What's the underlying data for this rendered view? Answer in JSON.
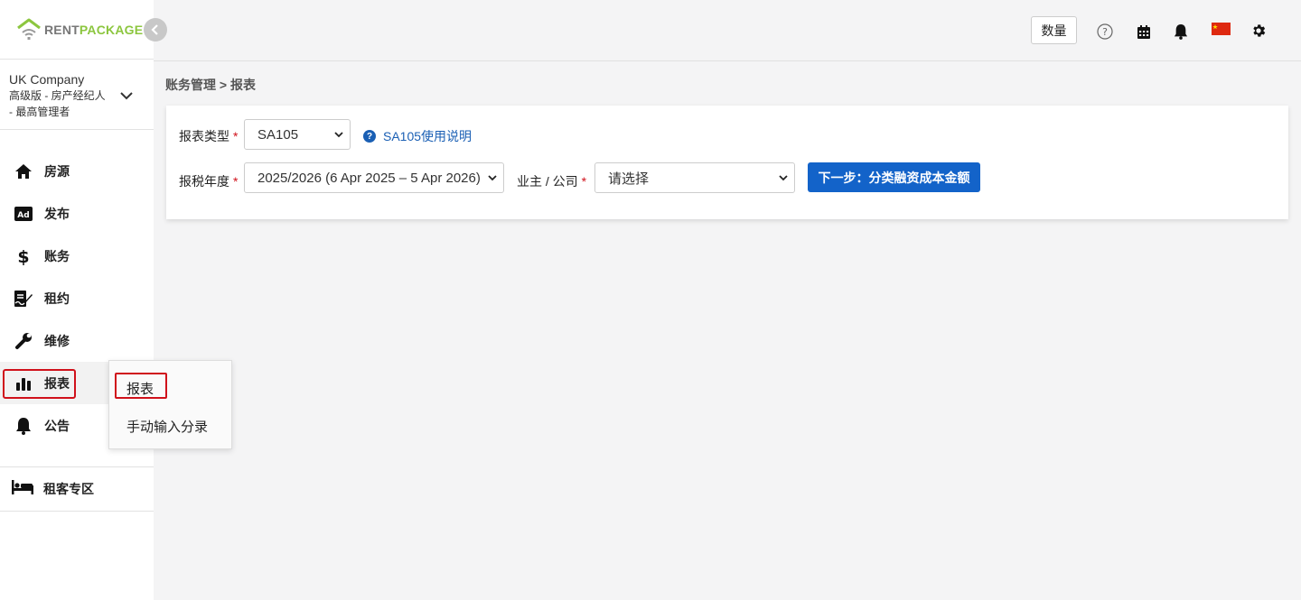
{
  "brand": {
    "name_part1": "RENT",
    "name_part2": "PACKAGE"
  },
  "company": {
    "name": "UK Company",
    "role_line1": "高级版 - 房产经纪人",
    "role_line2": "- 最高管理者"
  },
  "nav": {
    "items": [
      {
        "label": "房源",
        "icon": "home-icon"
      },
      {
        "label": "发布",
        "icon": "ad-icon"
      },
      {
        "label": "账务",
        "icon": "dollar-icon"
      },
      {
        "label": "租约",
        "icon": "contract-icon"
      },
      {
        "label": "维修",
        "icon": "wrench-icon"
      },
      {
        "label": "报表",
        "icon": "bar-chart-icon"
      },
      {
        "label": "公告",
        "icon": "bell-icon"
      }
    ],
    "tenant_label": "租客专区"
  },
  "flyout": {
    "items": [
      "报表",
      "手动输入分录"
    ]
  },
  "header": {
    "quantity_label": "数量"
  },
  "breadcrumb": "账务管理 > 报表",
  "form": {
    "report_type_label": "报表类型",
    "report_type_value": "SA105",
    "help_link": "SA105使用说明",
    "tax_year_label": "报税年度",
    "tax_year_value": "2025/2026 (6 Apr 2025 – 5 Apr 2026)",
    "owner_label": "业主 / 公司",
    "owner_value": "请选择",
    "required_mark": "*",
    "next_button": "下一步：分类融资成本金额"
  },
  "colors": {
    "accent": "#1363c9",
    "brand_green": "#8cc63f",
    "highlight_red": "#d0111b"
  }
}
